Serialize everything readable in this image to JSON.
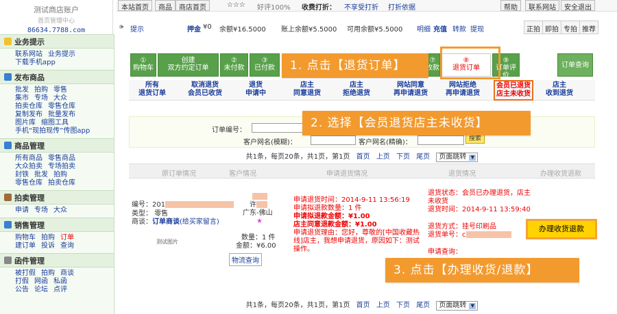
{
  "header": {
    "logo": {
      "title": "测试商店账户",
      "subtitle": "首页管理中心",
      "domain": "86634.7788.com"
    },
    "tabs": [
      "本站首页",
      "商品",
      "商店首页"
    ],
    "rating_stars": "☆☆☆",
    "good_rate": "好评100%",
    "return_label": "收费打折：",
    "return_value": "不享受打折",
    "return_link": "打折依据",
    "right_links": [
      "帮助",
      "联系网站",
      "安全退出"
    ],
    "tip_label": "提示",
    "deposit": "押金",
    "deposit_value": "¥0",
    "total_balance": "余额¥16.5000",
    "account_balance": "账上余额¥5.5000",
    "available_balance": "可用余额¥5.5000",
    "links": [
      "明细",
      "充值",
      "转款",
      "提现"
    ],
    "right_tabs": [
      "正拍",
      "即拍",
      "专拍",
      "推荐"
    ]
  },
  "sidebar": [
    {
      "title": "业务提示",
      "icon": "star-icon",
      "lines": [
        [
          "联系网站",
          "业务提示"
        ],
        [
          "下载手机app"
        ]
      ]
    },
    {
      "title": "发布商品",
      "icon": "document-icon",
      "lines": [
        [
          "批发",
          "拍购",
          "零售"
        ],
        [
          "集市",
          "专场",
          "大众"
        ],
        [
          "拍卖仓库",
          "零售仓库"
        ],
        [
          "复制发布",
          "批量发布"
        ],
        [
          "图片库",
          "缩图工具"
        ],
        [
          "手机“现拍现传”传图app"
        ]
      ]
    },
    {
      "title": "商品管理",
      "icon": "search-icon",
      "lines": [
        [
          "所有商品",
          "零售商品"
        ],
        [
          "大众拍卖",
          "专场拍卖"
        ],
        [
          "封铁",
          "批发",
          "拍购"
        ],
        [
          "零售仓库",
          "拍卖仓库"
        ]
      ]
    },
    {
      "title": "拍卖管理",
      "icon": "gavel-icon",
      "lines": [
        [
          "申请",
          "专场",
          "大众"
        ]
      ]
    },
    {
      "title": "销售管理",
      "icon": "cart-icon",
      "lines": [
        [
          "购物车",
          "拍购",
          "订单"
        ],
        [
          "建订单",
          "投诉",
          "查询"
        ]
      ]
    },
    {
      "title": "函件管理",
      "icon": "mail-icon",
      "lines": [
        [
          "被打假",
          "拍购",
          "商谈"
        ],
        [
          "打假",
          "网函",
          "私函"
        ],
        [
          "公告",
          "论坛",
          "点评"
        ]
      ]
    }
  ],
  "steps": [
    {
      "num": "①",
      "label": "购物车"
    },
    {
      "num": "",
      "label": "创建\n双方约定订单"
    },
    {
      "num": "②",
      "label": "未付款"
    },
    {
      "num": "③",
      "label": "已付款"
    },
    {
      "num": "⑦",
      "label": "收款"
    },
    {
      "num": "⑧",
      "label": "退货订单"
    },
    {
      "num": "⑨",
      "label": "订单评价"
    }
  ],
  "order_query": "订单查询",
  "subtabs": [
    {
      "label": "所有\n退货订单"
    },
    {
      "label": "取消退货\n会员已收货"
    },
    {
      "label": "退货\n申请中"
    },
    {
      "label": "店主\n同意退货"
    },
    {
      "label": "店主\n拒绝退货"
    },
    {
      "label": "网站同意\n再申请退货"
    },
    {
      "label": "网站拒绝\n再申请退货"
    },
    {
      "label": "会员已退货\n店主未收货"
    },
    {
      "label": "店主\n收到退货"
    }
  ],
  "filter": {
    "order_no": "订单编号：",
    "customer_name": "客户网名(模糊)：",
    "customer_name2": "客户网名(精确)：",
    "search": "搜索"
  },
  "pager": {
    "info": "共1条，每页20条，共1页，第1页",
    "first": "首页",
    "prev": "上页",
    "next": "下页",
    "last": "尾页",
    "jump": "页面跳转"
  },
  "table_headers": [
    "原订单情况",
    "客户情况",
    "申请退货情况",
    "退货情况",
    "办理收货退款"
  ],
  "order": {
    "no_label": "编号：201",
    "type_label": "类型：",
    "type_value": "零售",
    "deal_label": "商谈：",
    "deal_value": "订单商谈",
    "deal_note": "(给买家留言)",
    "image_text": "测试图片",
    "customer": "许",
    "location": "广东-佛山",
    "star": "★",
    "quantity": "数量：1 件",
    "amount": "金额：¥6.00",
    "logistics": "物流查询",
    "apply_time": "申请退货时间：2014-9-11 13:56:19",
    "apply_qty": "申请拟退款数量：1 件",
    "apply_amt": "申请拟退款金额：¥1.00",
    "agree_amt": "店主同意退款金额：¥1.00",
    "reason": "申请退货理由：您好，尊敬的[中国收藏热线]店主，我想申请退货，原因如下：测试操作。",
    "status": "退货状态：会员已办理退货，店主未收货",
    "return_time": "退货时间：2014-9-11 13:59:40",
    "method": "退货方式：挂号印刷品",
    "return_no": "退货单号：c",
    "apply_query": "申请查询："
  },
  "refund_button": "办理收货退款",
  "callouts": [
    "1. 点击【退货订单】",
    "2. 选择【会员退货店主未收货】",
    "3. 点击【办理收货/退款】"
  ],
  "colors": {
    "green": "#58a04a",
    "orange": "#f39a2e",
    "red": "#e00000",
    "link": "#1a3d9c"
  }
}
